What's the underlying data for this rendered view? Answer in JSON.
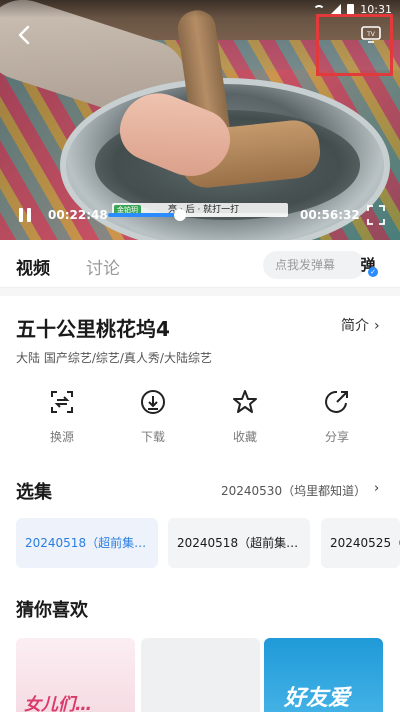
{
  "statusbar": {
    "time": "10:31"
  },
  "player": {
    "current_time": "00:22:48",
    "total_time": "00:56:32",
    "progress": 0.4,
    "danmaku_tag": "金铂玥",
    "danmaku_text": "亮 · 后 · 就打一打",
    "highlight_color": "#e23a3a"
  },
  "tabs": {
    "video": "视频",
    "discussion": "讨论",
    "danmaku_placeholder": "点我发弹幕",
    "danmaku_toggle": "弹"
  },
  "show": {
    "title": "五十公里桃花坞4",
    "intro_label": "简介",
    "tags": "大陆  国产综艺/综艺/真人秀/大陆综艺"
  },
  "actions": [
    {
      "label": "换源",
      "icon": "switch-source-icon"
    },
    {
      "label": "下载",
      "icon": "download-icon"
    },
    {
      "label": "收藏",
      "icon": "star-icon"
    },
    {
      "label": "分享",
      "icon": "share-icon"
    }
  ],
  "episodes": {
    "title": "选集",
    "current": "20240530（坞里都知道）",
    "items": [
      {
        "label": "20240518（超前集…",
        "active": true
      },
      {
        "label": "20240518（超前集…",
        "active": false
      },
      {
        "label": "20240525（",
        "active": false
      }
    ]
  },
  "recommend": {
    "title": "猜你喜欢",
    "items": [
      {
        "logo": "女儿们…"
      },
      {
        "logo": ""
      },
      {
        "logo": "好友爱"
      }
    ]
  },
  "colors": {
    "accent": "#2a7de0",
    "progress": "#2a8cff"
  }
}
